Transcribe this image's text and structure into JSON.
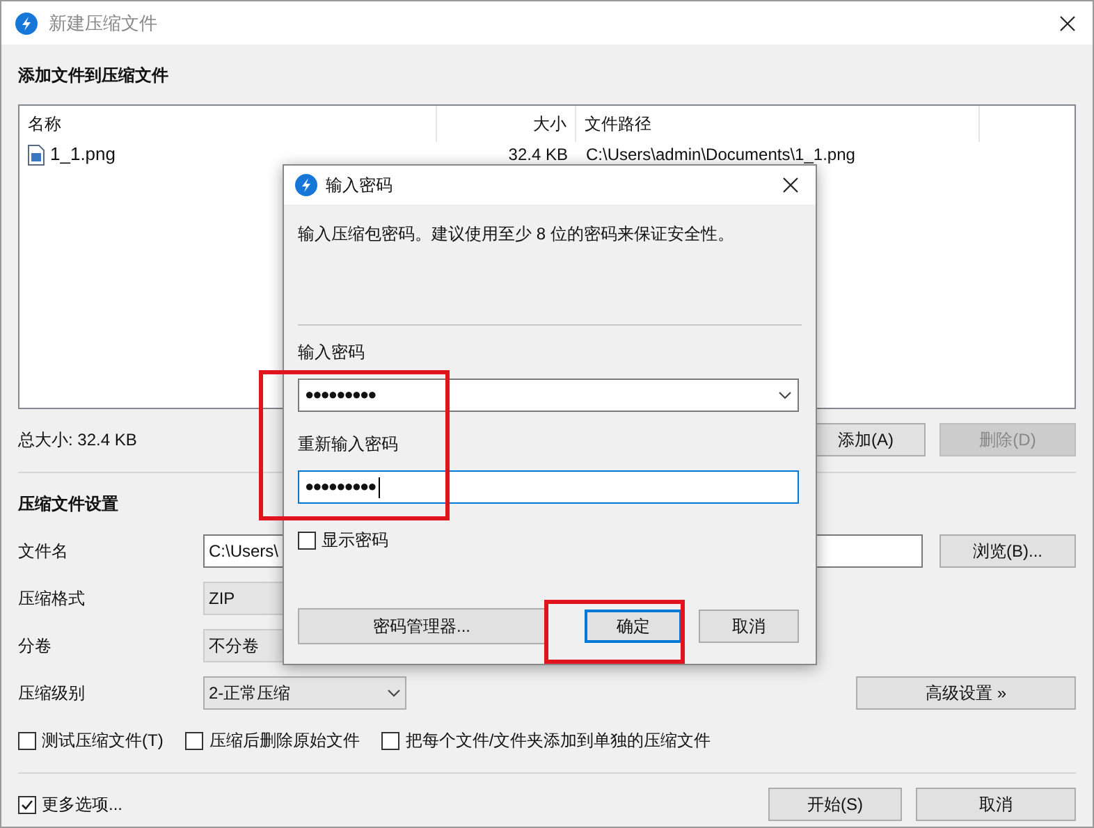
{
  "window": {
    "title": "新建压缩文件"
  },
  "files": {
    "heading": "添加文件到压缩文件",
    "columns": [
      "名称",
      "大小",
      "文件路径"
    ],
    "rows": [
      {
        "name": "1_1.png",
        "size": "32.4 KB",
        "path": "C:\\Users\\admin\\Documents\\1_1.png"
      }
    ],
    "total": "总大小: 32.4 KB",
    "buttons": [
      {
        "label": "添加(A)",
        "disabled": false
      },
      {
        "label": "删除(D)",
        "disabled": true
      }
    ]
  },
  "settings": {
    "heading": "压缩文件设置",
    "fields": [
      {
        "label": "文件名",
        "kind": "input",
        "value": "C:\\Users\\",
        "button": "浏览(B)..."
      },
      {
        "label": "压缩格式",
        "kind": "combo",
        "value": "ZIP"
      },
      {
        "label": "分卷",
        "kind": "combo",
        "value": "不分卷"
      },
      {
        "label": "压缩级别",
        "kind": "dropdown",
        "value": "2-正常压缩",
        "button": "高级设置 »"
      }
    ],
    "options": [
      {
        "label": "测试压缩文件(T)",
        "checked": false
      },
      {
        "label": "压缩后删除原始文件",
        "checked": false
      },
      {
        "label": "把每个文件/文件夹添加到单独的压缩文件",
        "checked": false
      }
    ]
  },
  "footer": {
    "more_options": {
      "label": "更多选项...",
      "checked": true
    },
    "buttons": [
      "开始(S)",
      "取消"
    ]
  },
  "dialog": {
    "title": "输入密码",
    "message": "输入压缩包密码。建议使用至少 8 位的密码来保证安全性。",
    "fields": [
      {
        "label": "输入密码",
        "kind": "combo",
        "value": "●●●●●●●●●",
        "focused": false
      },
      {
        "label": "重新输入密码",
        "kind": "input",
        "value": "●●●●●●●●●",
        "focused": true
      }
    ],
    "show_password": {
      "label": "显示密码",
      "checked": false
    },
    "buttons": [
      {
        "label": "密码管理器...",
        "default": false
      },
      {
        "label": "确定",
        "default": true
      },
      {
        "label": "取消",
        "default": false
      }
    ]
  }
}
